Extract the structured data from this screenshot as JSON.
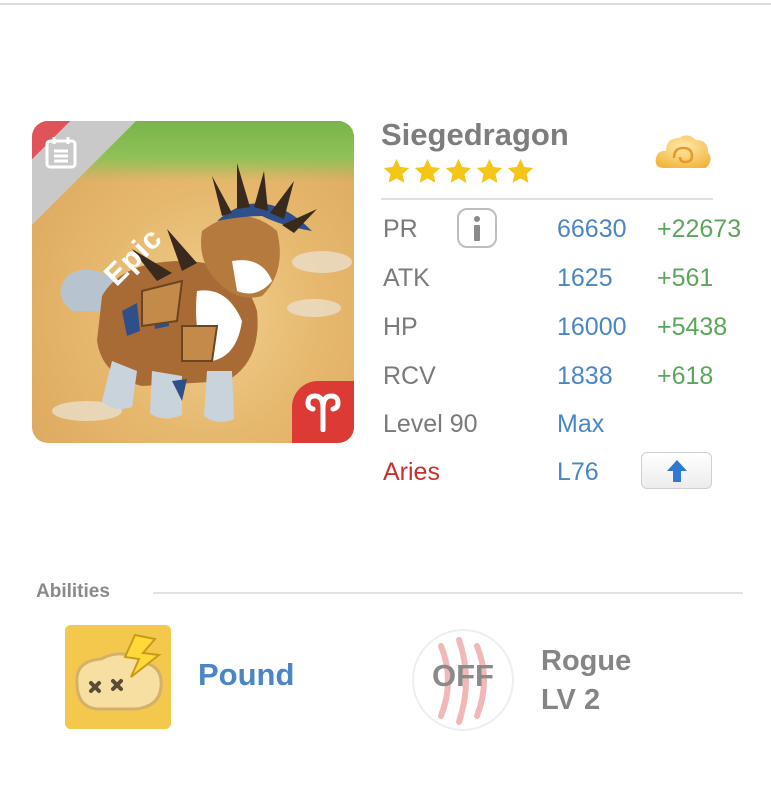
{
  "creature": {
    "name": "Siegedragon",
    "rarity": "Epic",
    "star_count": 5,
    "sign": "Aries"
  },
  "stats": {
    "pr": {
      "label": "PR",
      "value": "66630",
      "bonus": "+22673"
    },
    "atk": {
      "label": "ATK",
      "value": "1625",
      "bonus": "+561"
    },
    "hp": {
      "label": "HP",
      "value": "16000",
      "bonus": "+5438"
    },
    "rcv": {
      "label": "RCV",
      "value": "1838",
      "bonus": "+618"
    },
    "level": {
      "label": "Level 90",
      "value": "Max"
    },
    "sign": {
      "label": "Aries",
      "value": "L76"
    }
  },
  "abilities": {
    "header": "Abilities",
    "ability": {
      "name": "Pound"
    },
    "passive": {
      "state": "OFF",
      "name": "Rogue",
      "level": "LV 2"
    }
  },
  "icons": {
    "calendar": "calendar-icon",
    "aries": "aries-symbol-icon",
    "cloud": "element-cloud-icon",
    "info": "info-icon",
    "upgrade": "arrow-up-icon",
    "pound": "pound-ability-icon",
    "claw": "claw-icon"
  },
  "colors": {
    "rarity_ribbon": "#e0535a",
    "value_blue": "#4a86c5",
    "bonus_green": "#5aa65a",
    "sign_red": "#c9302c",
    "star_gold": "#f5c518"
  }
}
